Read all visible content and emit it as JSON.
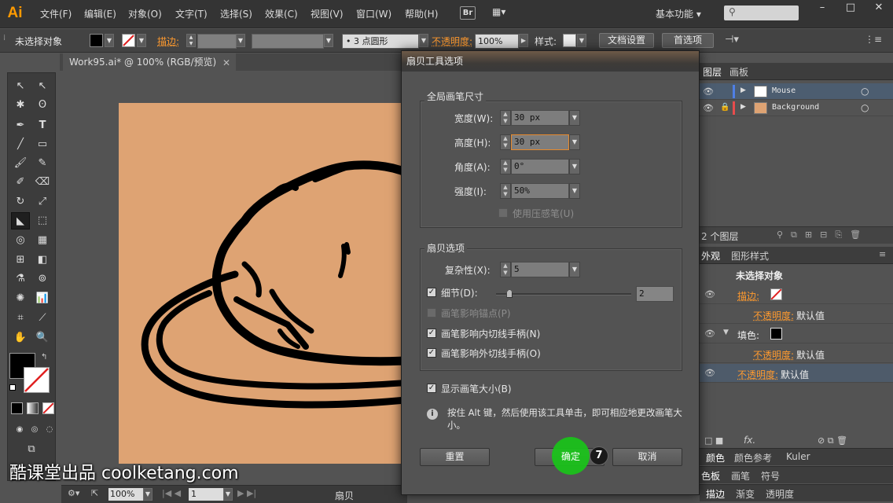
{
  "app": {
    "logo": "Ai"
  },
  "menubar": {
    "items": [
      "文件(F)",
      "编辑(E)",
      "对象(O)",
      "文字(T)",
      "选择(S)",
      "效果(C)",
      "视图(V)",
      "窗口(W)",
      "帮助(H)"
    ],
    "bridge": "Br",
    "arrange": "▦▾",
    "workspace": "基本功能 ▾",
    "search_icon": "⚲",
    "win_minimize": "–",
    "win_maximize": "□",
    "win_close": "✕"
  },
  "control": {
    "selection": "未选择对象",
    "stroke_label": "描边:",
    "brush": "•  3 点圆形",
    "opacity_label": "不透明度:",
    "opacity_value": "100%",
    "style_label": "样式:",
    "doc_setup": "文档设置",
    "prefs": "首选项"
  },
  "document": {
    "tab": "Work95.ai* @ 100% (RGB/预览)",
    "close": "✕",
    "zoom": "100%",
    "page": "1",
    "status_tool": "扇贝"
  },
  "layers": {
    "tabs": [
      "图层",
      "画板"
    ],
    "rows": [
      {
        "name": "Mouse",
        "color": "#4f7fe6"
      },
      {
        "name": "Background",
        "color": "#e84c4c"
      }
    ],
    "count": "2 个图层"
  },
  "appearance": {
    "tabs": [
      "外观",
      "图形样式"
    ],
    "header": "未选择对象",
    "rows": [
      {
        "label": "描边:",
        "value": ""
      },
      {
        "label": "不透明度:",
        "value": "默认值"
      },
      {
        "label": "填色:",
        "value": ""
      },
      {
        "label": "不透明度:",
        "value": "默认值"
      },
      {
        "label": "不透明度:",
        "value": "默认值"
      }
    ],
    "fx": "fx."
  },
  "bottom_tabs": {
    "row1": [
      "颜色",
      "颜色参考",
      "Kuler"
    ],
    "row2": [
      "色板",
      "画笔",
      "符号"
    ],
    "row3": [
      "描边",
      "渐变",
      "透明度"
    ]
  },
  "dialog": {
    "title": "扇贝工具选项",
    "global_group": "全局画笔尺寸",
    "width_label": "宽度(W):",
    "width_value": "30 px",
    "height_label": "高度(H):",
    "height_value": "30 px",
    "angle_label": "角度(A):",
    "angle_value": "0°",
    "intensity_label": "强度(I):",
    "intensity_value": "50%",
    "pressure_label": "使用压感笔(U)",
    "scallop_group": "扇贝选项",
    "complexity_label": "复杂性(X):",
    "complexity_value": "5",
    "detail_label": "细节(D):",
    "detail_value": "2",
    "detail_fraction": 0.1,
    "brush_anchor_label": "画笔影响锚点(P)",
    "in_tangent_label": "画笔影响内切线手柄(N)",
    "out_tangent_label": "画笔影响外切线手柄(O)",
    "show_size_label": "显示画笔大小(B)",
    "info_icon": "i",
    "info_text": "按住 Alt 键，然后使用该工具单击，即可相应地更改画笔大小。",
    "reset": "重置",
    "ok": "确定",
    "cancel": "取消",
    "step": "7"
  },
  "watermark": "酷课堂出品 coolketang.com"
}
